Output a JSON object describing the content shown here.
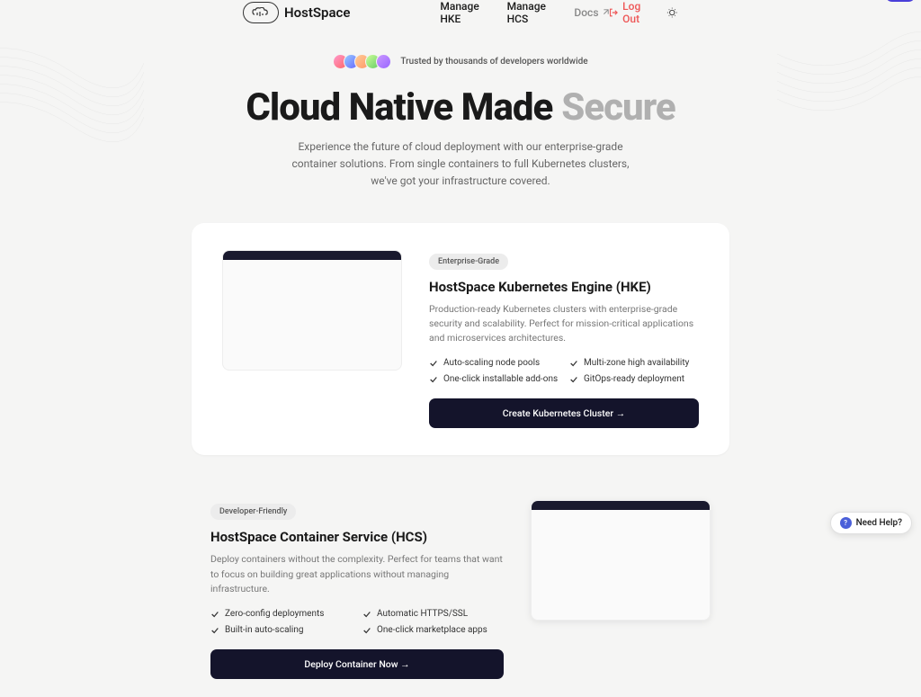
{
  "brand": "HostSpace",
  "nav": {
    "manage_hke": "Manage HKE",
    "manage_hcs": "Manage HCS",
    "docs": "Docs",
    "logout": "Log Out"
  },
  "hero": {
    "trusted": "Trusted by thousands of developers worldwide",
    "headline_a": "Cloud Native Made",
    "headline_b": "Secure",
    "subhead": "Experience the future of cloud deployment with our enterprise-grade container solutions. From single containers to full Kubernetes clusters, we've got your infrastructure covered."
  },
  "hke": {
    "badge": "Enterprise-Grade",
    "title": "HostSpace Kubernetes Engine (HKE)",
    "desc": "Production-ready Kubernetes clusters with enterprise-grade security and scalability. Perfect for mission-critical applications and microservices architectures.",
    "features": [
      "Auto-scaling node pools",
      "Multi-zone high availability",
      "One-click installable add-ons",
      "GitOps-ready deployment"
    ],
    "cta": "Create Kubernetes Cluster →"
  },
  "hcs": {
    "badge": "Developer-Friendly",
    "title": "HostSpace Container Service (HCS)",
    "desc": "Deploy containers without the complexity. Perfect for teams that want to focus on building great applications without managing infrastructure.",
    "features": [
      "Zero-config deployments",
      "Automatic HTTPS/SSL",
      "Built-in auto-scaling",
      "One-click marketplace apps"
    ],
    "cta": "Deploy Container Now →"
  },
  "help": "Need Help?"
}
